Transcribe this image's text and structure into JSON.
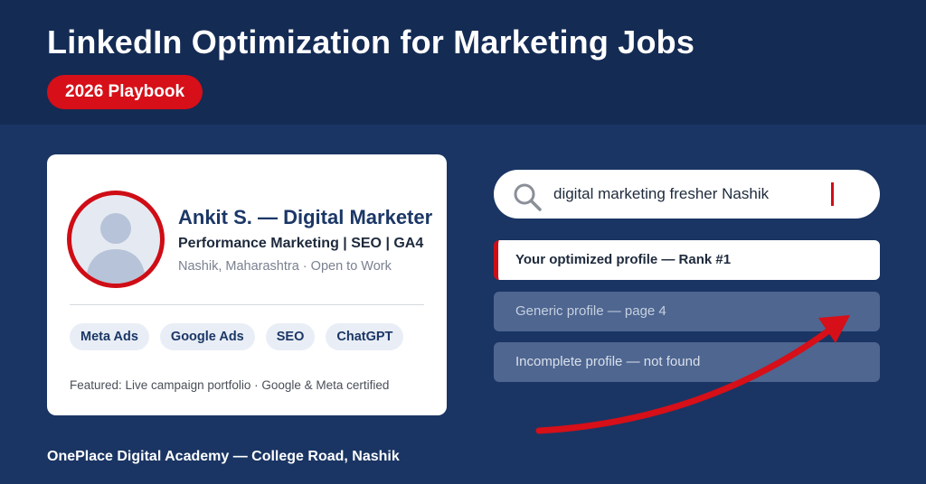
{
  "header": {
    "title": "LinkedIn Optimization for Marketing Jobs",
    "badge": "2026 Playbook"
  },
  "profile_card": {
    "name": "Ankit S. — Digital Marketer",
    "headline": "Performance Marketing | SEO | GA4",
    "location": "Nashik, Maharashtra · Open to Work",
    "skills": [
      "Meta Ads",
      "Google Ads",
      "SEO",
      "ChatGPT"
    ],
    "featured": "Featured: Live campaign portfolio · Google & Meta certified"
  },
  "search": {
    "query": "digital marketing fresher Nashik",
    "icon": "search-icon"
  },
  "results": [
    {
      "label": "Your optimized profile — Rank #1"
    },
    {
      "label": "Generic profile — page 4"
    },
    {
      "label": "Incomplete profile — not found"
    }
  ],
  "footer": {
    "text": "OnePlace Digital Academy — College Road, Nashik"
  },
  "colors": {
    "background": "#1a3563",
    "header_band": "#142b54",
    "accent_red": "#d60f18",
    "card": "#ffffff",
    "muted_result": "#4e6690"
  }
}
